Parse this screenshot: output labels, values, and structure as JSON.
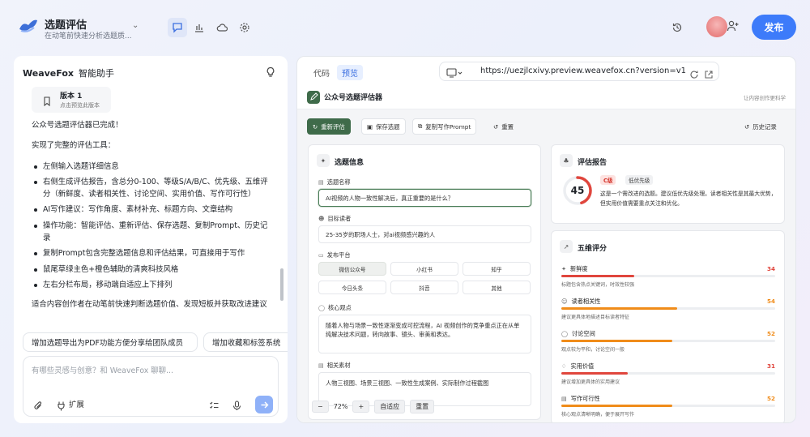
{
  "project": {
    "title": "选题评估",
    "subtitle": "在动笔前快速分析选题质..."
  },
  "toolbar": {
    "publish_label": "发布"
  },
  "chat": {
    "assistant_name": "WeaveFox",
    "assistant_role": "智能助手",
    "version": {
      "title": "版本 1",
      "subtitle": "点击预览此版本"
    },
    "message": {
      "p1": "公众号选题评估器已完成！",
      "p2": "实现了完整的评估工具：",
      "items": [
        "左侧输入选题详细信息",
        "右侧生成评估报告，含总分0-100、等级S/A/B/C、优先级、五维评分（新鲜度、读者相关性、讨论空间、实用价值、写作可行性）",
        "AI写作建议：写作角度、素材补充、标题方向、文章结构",
        "操作功能：智能评估、重新评估、保存选题、复制Prompt、历史记录",
        "复制Prompt包含完整选题信息和评估结果，可直接用于写作",
        "鼠尾草绿主色+橙色辅助的清爽科技风格",
        "左右分栏布局，移动端自适应上下排列"
      ],
      "p3": "适合内容创作者在动笔前快速判断选题价值、发现短板并获取改进建议"
    },
    "suggestions": [
      "增加选题导出为PDF功能方便分享给团队成员",
      "增加收藏和标签系统"
    ],
    "input_placeholder": "有哪些灵感与创意？和 WeaveFox 聊聊...",
    "expand_label": "扩展"
  },
  "preview": {
    "tabs": [
      "代码",
      "预览"
    ],
    "url": "https://uezjlcxivy.preview.weavefox.cn?version=v1",
    "app": {
      "title": "公众号选题评估器",
      "tagline": "让内容创作更科学",
      "buttons": {
        "reevaluate": "重新评估",
        "save": "保存选题",
        "copy_prompt": "复制写作Prompt",
        "reset": "重置",
        "history": "历史记录"
      },
      "topic_card": {
        "title": "选题信息",
        "name_label": "选题名称",
        "name_value": "AI视频的人物一致性解决后，真正重要的是什么？",
        "readers_label": "目标读者",
        "readers_value": "25-35岁的职场人士，对ai视频感兴趣的人",
        "platform_label": "发布平台",
        "platforms": [
          "微信公众号",
          "小红书",
          "知乎",
          "今日头条",
          "抖音",
          "其他"
        ],
        "view_label": "核心观点",
        "view_value": "随着人物与场景一致性逐渐变成可控流程，AI 视频创作的竞争重点正在从单纯解决技术问题，转向故事、镜头、审美和表达。",
        "material_label": "相关素材",
        "material_value": "人物三视图、场景三视图、一致性生成案例、实际制作过程截图"
      },
      "zoom": {
        "level": "72%",
        "fit": "自适应",
        "reset": "重置"
      },
      "report": {
        "title": "评估报告",
        "score": 45,
        "grade": "C级",
        "priority": "低优先级",
        "summary": "这是一个需改进的选题。建议低优先级处理。读者相关性是其最大优势，但实用价值需要重点关注和优化。",
        "accent": "#e0463d"
      },
      "dimensions": {
        "title": "五维评分",
        "items": [
          {
            "name": "新鲜度",
            "score": 34,
            "note": "标题包含热点关键词，时效性较强",
            "color": "#e0463d"
          },
          {
            "name": "读者相关性",
            "score": 54,
            "note": "建议更具体地描述目标读者特征",
            "color": "#f08c1a"
          },
          {
            "name": "讨论空间",
            "score": 52,
            "note": "观点较为平和，讨论空间一般",
            "color": "#f08c1a"
          },
          {
            "name": "实用价值",
            "score": 31,
            "note": "建议增加更具体的实用建议",
            "color": "#e0463d"
          },
          {
            "name": "写作可行性",
            "score": 52,
            "note": "核心观点清晰明确，便于展开写作",
            "color": "#f08c1a"
          }
        ]
      }
    }
  }
}
